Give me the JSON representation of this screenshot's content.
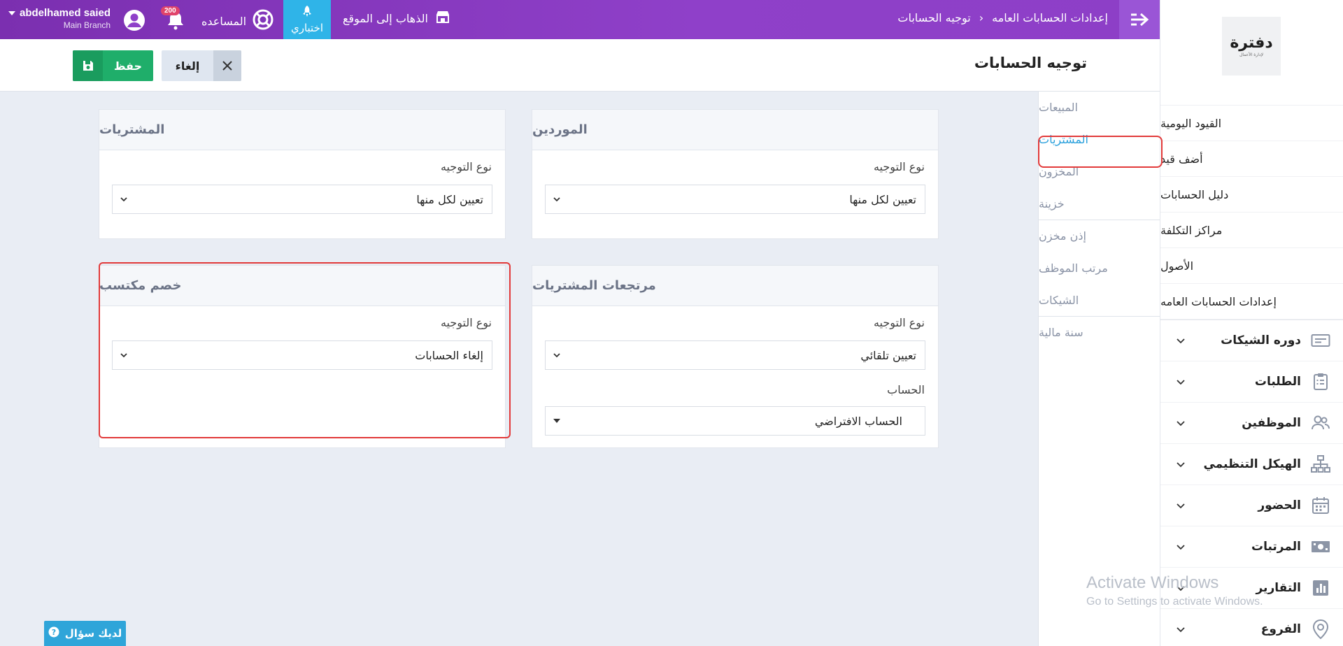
{
  "topbar": {
    "breadcrumb": [
      "إعدادات الحسابات العامه",
      "توجيه الحسابات"
    ],
    "user_name": "abdelhamed saied",
    "branch": "Main Branch",
    "notifications_count": "200",
    "help_label": "المساعده",
    "trial_label": "اختباري",
    "goto_site_label": "الذهاب إلى الموقع"
  },
  "page": {
    "title": "توجيه الحسابات",
    "save_label": "حفظ",
    "cancel_label": "إلغاء"
  },
  "sidebar": {
    "logo_text": "دفترة",
    "logo_sub": "لإدارة الأعمال",
    "sub_items": [
      "القيود اليومية",
      "أضف قيد",
      "دليل الحسابات",
      "مراكز التكلفة",
      "الأصول",
      "إعدادات الحسابات العامه"
    ],
    "nav_items": [
      {
        "label": "دوره الشيكات",
        "icon": "checks-icon"
      },
      {
        "label": "الطلبات",
        "icon": "clipboard-icon"
      },
      {
        "label": "الموظفين",
        "icon": "users-icon"
      },
      {
        "label": "الهيكل التنظيمي",
        "icon": "org-chart-icon"
      },
      {
        "label": "الحضور",
        "icon": "calendar-icon"
      },
      {
        "label": "المرتبات",
        "icon": "money-icon"
      },
      {
        "label": "التقارير",
        "icon": "chart-icon"
      },
      {
        "label": "الفروع",
        "icon": "location-icon"
      }
    ]
  },
  "tabs": [
    "المبيعات",
    "المشتريات",
    "المخزون",
    "خزينة",
    "إذن مخزن",
    "مرتب الموظف",
    "الشيكات",
    "سنة مالية"
  ],
  "active_tab": "المشتريات",
  "cards": {
    "suppliers": {
      "title": "الموردين",
      "field_label": "نوع التوجيه",
      "value": "تعيين لكل منها"
    },
    "purchases": {
      "title": "المشتريات",
      "field_label": "نوع التوجيه",
      "value": "تعيين لكل منها"
    },
    "purchase_returns": {
      "title": "مرتجعات المشتريات",
      "field_label": "نوع التوجيه",
      "value": "تعيين تلقائي",
      "account_label": "الحساب",
      "account_value": "الحساب الافتراضي"
    },
    "earned_discount": {
      "title": "خصم مكتسب",
      "field_label": "نوع التوجيه",
      "value": "إلغاء الحسابات"
    }
  },
  "watermark": {
    "line1": "Activate Windows",
    "line2": "Go to Settings to activate Windows."
  },
  "question_label": "لديك سؤال",
  "colors": {
    "topbar": "#8f40c9",
    "accent": "#2fb4e8",
    "save": "#1fae6a",
    "highlight": "#e23a3a"
  }
}
